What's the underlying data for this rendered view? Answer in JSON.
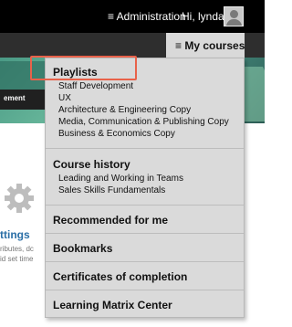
{
  "header": {
    "admin_label": "≡ Administration",
    "greeting": "Hi, lynda"
  },
  "nav": {
    "my_courses_label": "≡ My courses"
  },
  "banner": {
    "text": "ement"
  },
  "background": {
    "settings_title": "ttings",
    "settings_line1": "ributes, dc",
    "settings_line2": "id set time"
  },
  "dropdown": {
    "playlists": {
      "title": "Playlists",
      "items": [
        "Staff Development",
        "UX",
        "Architecture & Engineering Copy",
        "Media, Communication & Publishing Copy",
        "Business & Economics Copy"
      ]
    },
    "course_history": {
      "title": "Course history",
      "items": [
        "Leading and Working in Teams",
        "Sales Skills Fundamentals"
      ]
    },
    "recommended": "Recommended for me",
    "bookmarks": "Bookmarks",
    "certificates": "Certificates of completion",
    "learning_matrix": "Learning Matrix Center"
  },
  "colors": {
    "topbar": "#000000",
    "navbar": "#2e2e2e",
    "dropdown_bg": "#dadada",
    "highlight": "#e8624a",
    "settings_link": "#2b6fa6"
  }
}
